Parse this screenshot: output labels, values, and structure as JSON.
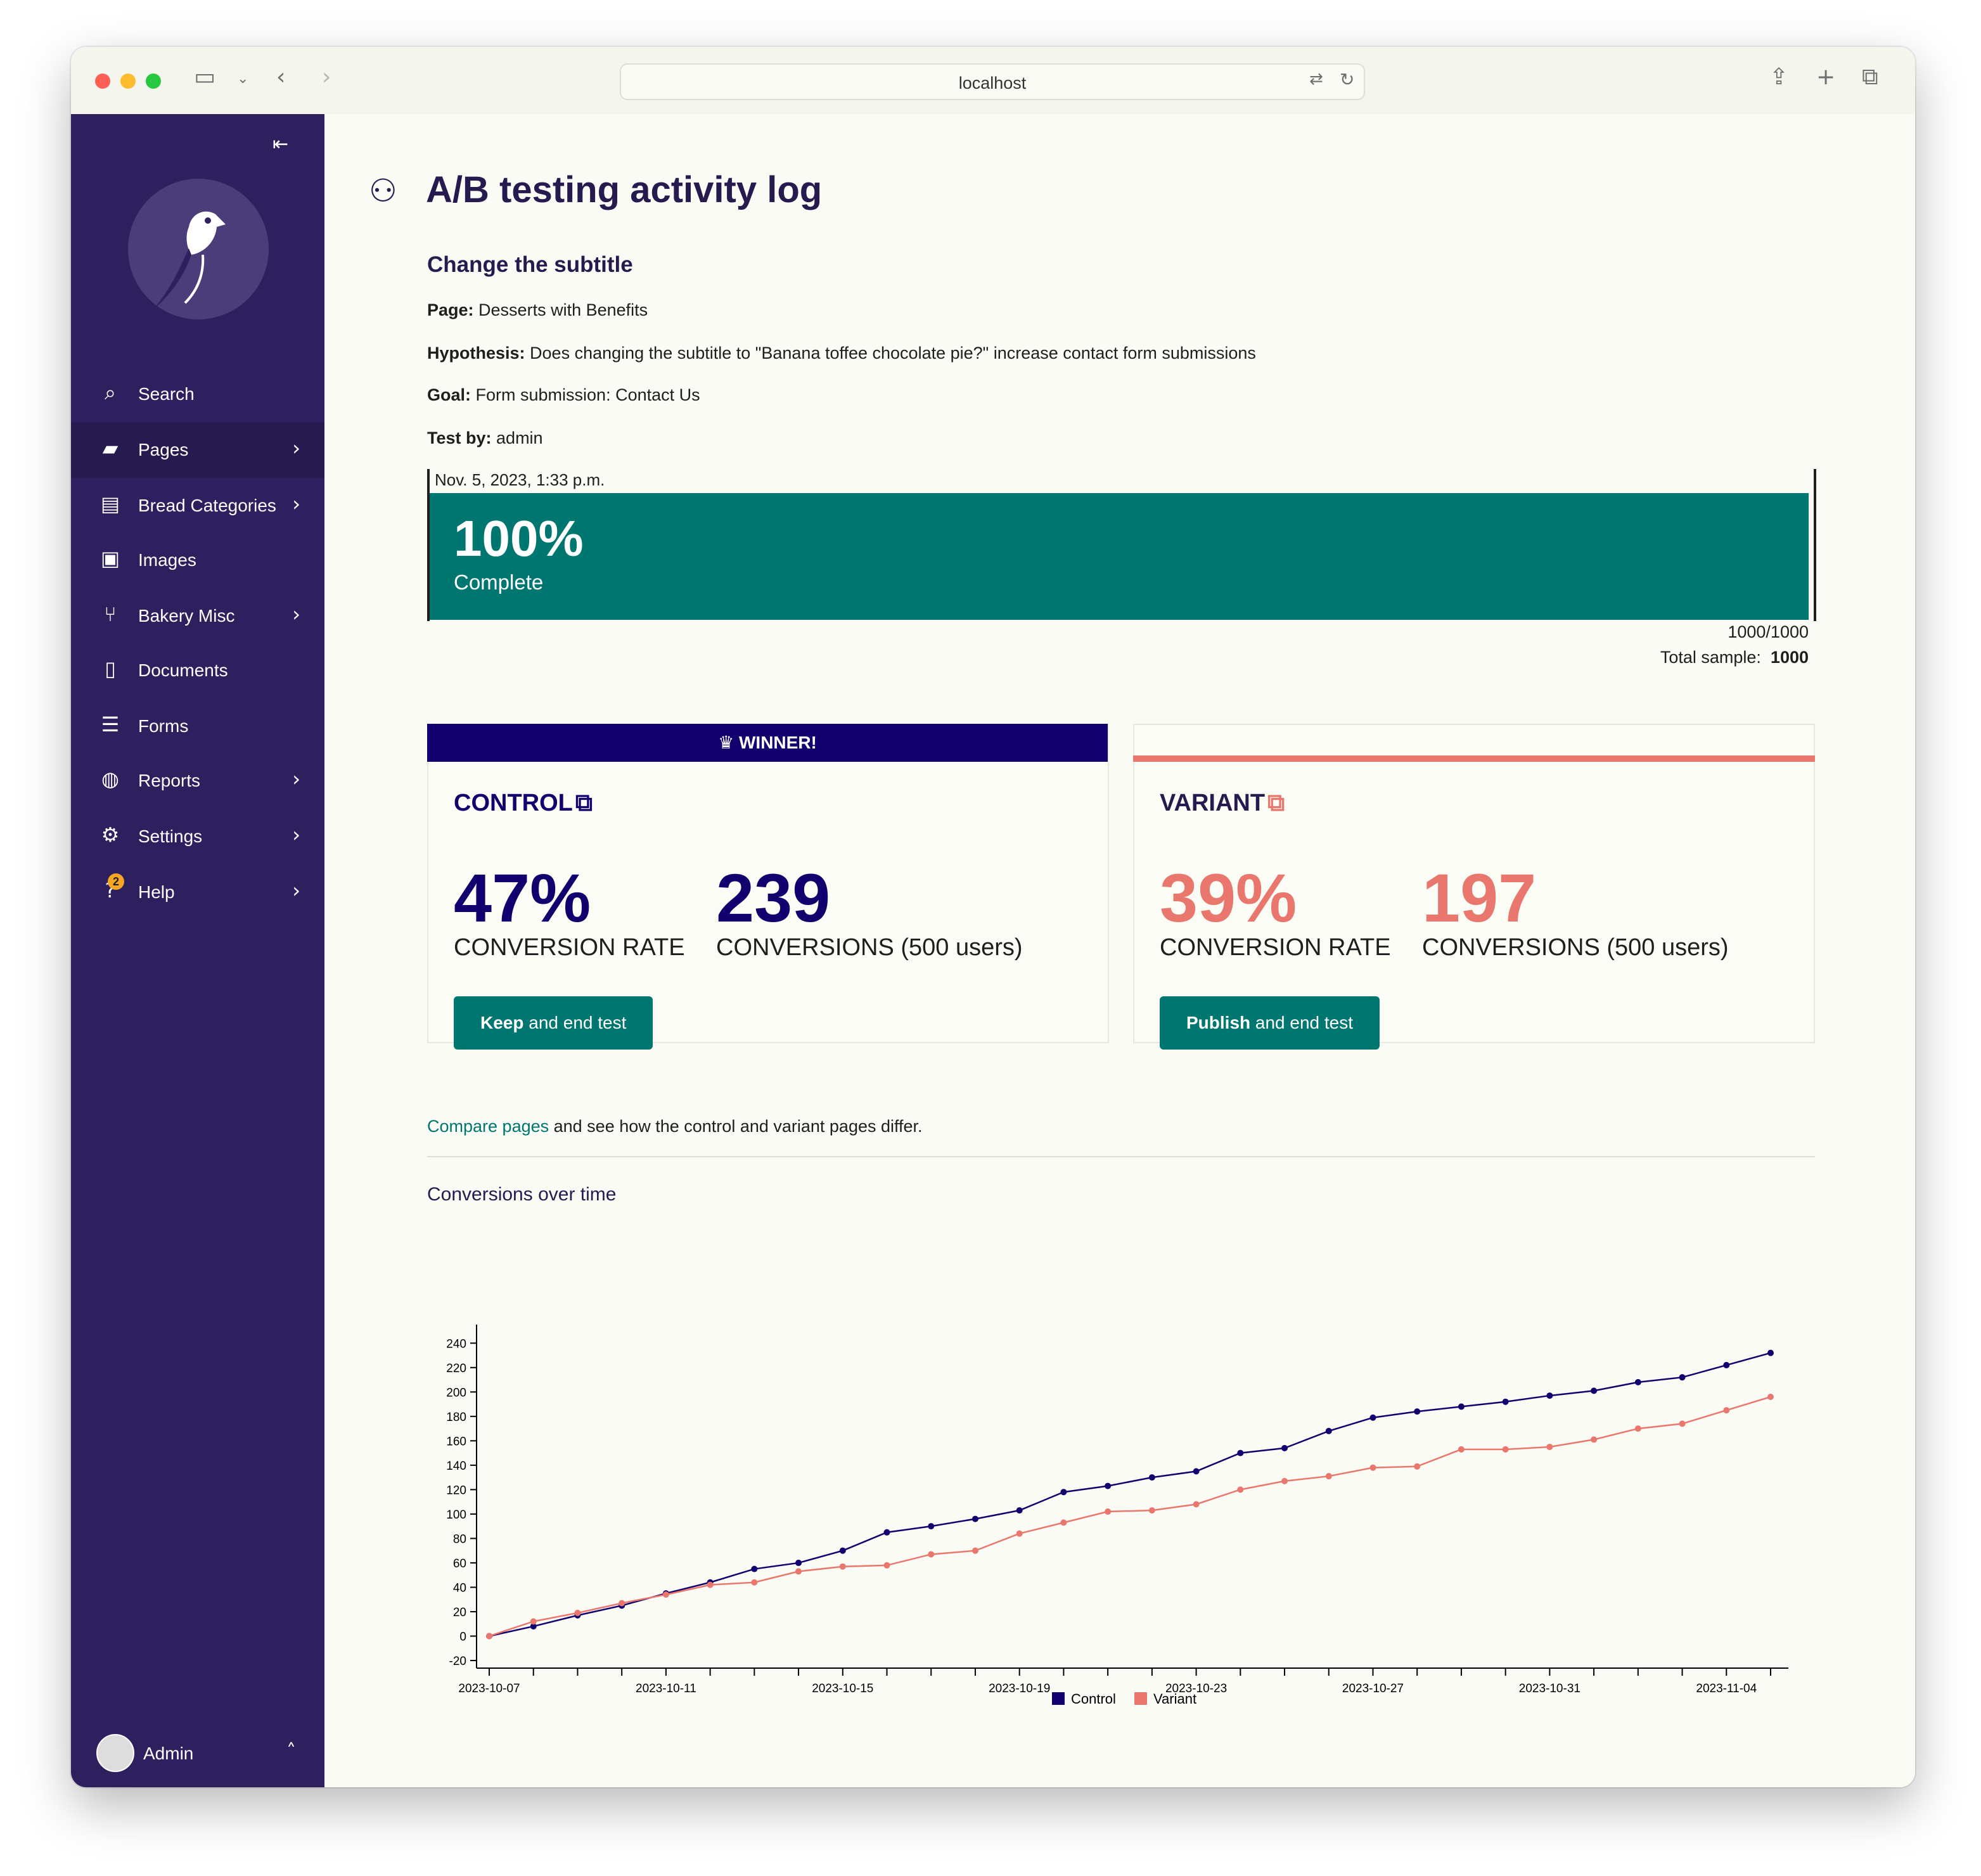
{
  "browser": {
    "url": "localhost"
  },
  "sidebar": {
    "collapse_icon": "collapse-sidebar-icon",
    "items": [
      {
        "label": "Search",
        "icon": "search-icon",
        "chevron": false,
        "active": false
      },
      {
        "label": "Pages",
        "icon": "folder-open-icon",
        "chevron": true,
        "active": true
      },
      {
        "label": "Bread Categories",
        "icon": "suitcase-icon",
        "chevron": true,
        "active": false
      },
      {
        "label": "Images",
        "icon": "image-icon",
        "chevron": false,
        "active": false
      },
      {
        "label": "Bakery Misc",
        "icon": "utensils-icon",
        "chevron": true,
        "active": false
      },
      {
        "label": "Documents",
        "icon": "document-icon",
        "chevron": false,
        "active": false
      },
      {
        "label": "Forms",
        "icon": "list-icon",
        "chevron": false,
        "active": false
      },
      {
        "label": "Reports",
        "icon": "globe-icon",
        "chevron": true,
        "active": false
      },
      {
        "label": "Settings",
        "icon": "cogs-icon",
        "chevron": true,
        "active": false
      },
      {
        "label": "Help",
        "icon": "help-icon",
        "chevron": true,
        "active": false,
        "badge": "2"
      }
    ],
    "account": {
      "name": "Admin"
    }
  },
  "page": {
    "title": "A/B testing activity log",
    "test_name": "Change the subtitle",
    "meta": {
      "page_label": "Page:",
      "page_value": "Desserts with Benefits",
      "hypothesis_label": "Hypothesis:",
      "hypothesis_value": "Does changing the subtitle to \"Banana toffee chocolate pie?\" increase contact form submissions",
      "goal_label": "Goal:",
      "goal_value": "Form submission: Contact Us",
      "testby_label": "Test by:",
      "testby_value": "admin"
    },
    "progress": {
      "date": "Nov. 5, 2023, 1:33 p.m.",
      "percent": "100%",
      "fraction": 1.0,
      "status": "Complete",
      "count": "1000/1000",
      "total_label": "Total sample:",
      "total_value": "1000"
    },
    "winner_label": "WINNER!",
    "control": {
      "title": "CONTROL",
      "rate": "47%",
      "rate_label": "CONVERSION RATE",
      "conversions": "239",
      "conversions_label": "CONVERSIONS (500 users)",
      "button_strong": "Keep",
      "button_rest": " and end test",
      "color": "#12006e"
    },
    "variant": {
      "title": "VARIANT",
      "rate": "39%",
      "rate_label": "CONVERSION RATE",
      "conversions": "197",
      "conversions_label": "CONVERSIONS (500 users)",
      "button_strong": "Publish",
      "button_rest": " and end test",
      "color": "#e9776d"
    },
    "compare": {
      "link": "Compare pages",
      "rest": " and see how the control and variant pages differ."
    },
    "chart_heading": "Conversions over time"
  },
  "chart_data": {
    "type": "line",
    "title": "Conversions over time",
    "xlabel": "",
    "ylabel": "",
    "x": [
      "2023-10-07",
      "2023-10-08",
      "2023-10-09",
      "2023-10-10",
      "2023-10-11",
      "2023-10-12",
      "2023-10-13",
      "2023-10-14",
      "2023-10-15",
      "2023-10-16",
      "2023-10-17",
      "2023-10-18",
      "2023-10-19",
      "2023-10-20",
      "2023-10-21",
      "2023-10-22",
      "2023-10-23",
      "2023-10-24",
      "2023-10-25",
      "2023-10-26",
      "2023-10-27",
      "2023-10-28",
      "2023-10-29",
      "2023-10-30",
      "2023-10-31",
      "2023-11-01",
      "2023-11-02",
      "2023-11-03",
      "2023-11-04",
      "2023-11-05"
    ],
    "x_ticks": [
      "2023-10-07",
      "2023-10-11",
      "2023-10-15",
      "2023-10-19",
      "2023-10-23",
      "2023-10-27",
      "2023-10-31",
      "2023-11-04"
    ],
    "ylim": [
      -20,
      250
    ],
    "y_ticks": [
      -20,
      0,
      20,
      40,
      60,
      80,
      100,
      120,
      140,
      160,
      180,
      200,
      220,
      240
    ],
    "legend": "bottom",
    "grid": false,
    "series": [
      {
        "name": "Control",
        "color": "#12006e",
        "values": [
          0,
          8,
          17,
          25,
          35,
          44,
          55,
          60,
          70,
          85,
          90,
          96,
          103,
          118,
          123,
          130,
          135,
          150,
          154,
          168,
          179,
          184,
          188,
          192,
          197,
          201,
          208,
          212,
          222,
          232
        ]
      },
      {
        "name": "Variant",
        "color": "#e9776d",
        "values": [
          0,
          12,
          19,
          27,
          34,
          42,
          44,
          53,
          57,
          58,
          67,
          70,
          84,
          93,
          102,
          103,
          108,
          120,
          127,
          131,
          138,
          139,
          153,
          153,
          155,
          161,
          170,
          174,
          185,
          196
        ]
      }
    ]
  }
}
